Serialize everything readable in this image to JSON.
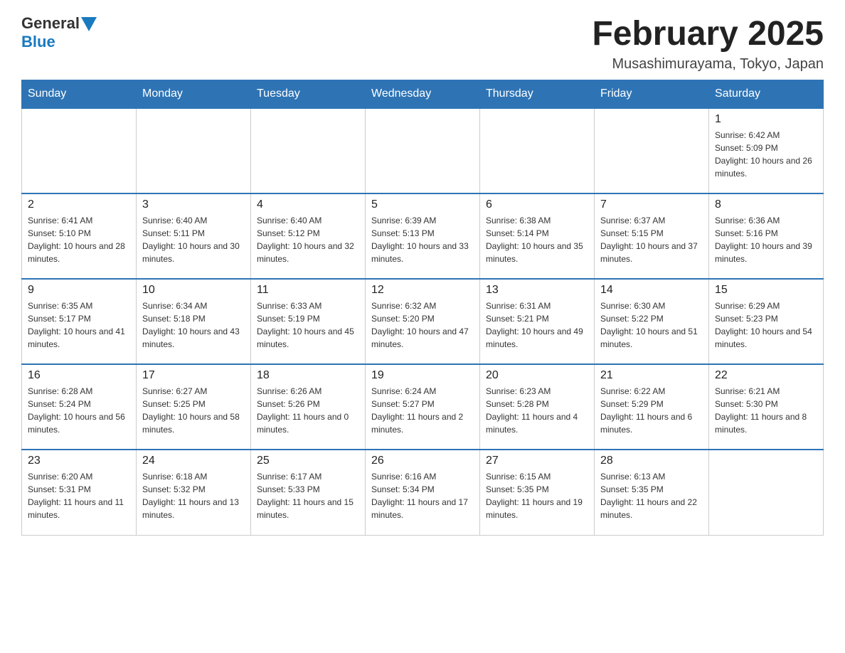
{
  "logo": {
    "general": "General",
    "blue": "Blue"
  },
  "title": "February 2025",
  "subtitle": "Musashimurayama, Tokyo, Japan",
  "weekdays": [
    "Sunday",
    "Monday",
    "Tuesday",
    "Wednesday",
    "Thursday",
    "Friday",
    "Saturday"
  ],
  "weeks": [
    [
      {
        "day": "",
        "info": ""
      },
      {
        "day": "",
        "info": ""
      },
      {
        "day": "",
        "info": ""
      },
      {
        "day": "",
        "info": ""
      },
      {
        "day": "",
        "info": ""
      },
      {
        "day": "",
        "info": ""
      },
      {
        "day": "1",
        "info": "Sunrise: 6:42 AM\nSunset: 5:09 PM\nDaylight: 10 hours and 26 minutes."
      }
    ],
    [
      {
        "day": "2",
        "info": "Sunrise: 6:41 AM\nSunset: 5:10 PM\nDaylight: 10 hours and 28 minutes."
      },
      {
        "day": "3",
        "info": "Sunrise: 6:40 AM\nSunset: 5:11 PM\nDaylight: 10 hours and 30 minutes."
      },
      {
        "day": "4",
        "info": "Sunrise: 6:40 AM\nSunset: 5:12 PM\nDaylight: 10 hours and 32 minutes."
      },
      {
        "day": "5",
        "info": "Sunrise: 6:39 AM\nSunset: 5:13 PM\nDaylight: 10 hours and 33 minutes."
      },
      {
        "day": "6",
        "info": "Sunrise: 6:38 AM\nSunset: 5:14 PM\nDaylight: 10 hours and 35 minutes."
      },
      {
        "day": "7",
        "info": "Sunrise: 6:37 AM\nSunset: 5:15 PM\nDaylight: 10 hours and 37 minutes."
      },
      {
        "day": "8",
        "info": "Sunrise: 6:36 AM\nSunset: 5:16 PM\nDaylight: 10 hours and 39 minutes."
      }
    ],
    [
      {
        "day": "9",
        "info": "Sunrise: 6:35 AM\nSunset: 5:17 PM\nDaylight: 10 hours and 41 minutes."
      },
      {
        "day": "10",
        "info": "Sunrise: 6:34 AM\nSunset: 5:18 PM\nDaylight: 10 hours and 43 minutes."
      },
      {
        "day": "11",
        "info": "Sunrise: 6:33 AM\nSunset: 5:19 PM\nDaylight: 10 hours and 45 minutes."
      },
      {
        "day": "12",
        "info": "Sunrise: 6:32 AM\nSunset: 5:20 PM\nDaylight: 10 hours and 47 minutes."
      },
      {
        "day": "13",
        "info": "Sunrise: 6:31 AM\nSunset: 5:21 PM\nDaylight: 10 hours and 49 minutes."
      },
      {
        "day": "14",
        "info": "Sunrise: 6:30 AM\nSunset: 5:22 PM\nDaylight: 10 hours and 51 minutes."
      },
      {
        "day": "15",
        "info": "Sunrise: 6:29 AM\nSunset: 5:23 PM\nDaylight: 10 hours and 54 minutes."
      }
    ],
    [
      {
        "day": "16",
        "info": "Sunrise: 6:28 AM\nSunset: 5:24 PM\nDaylight: 10 hours and 56 minutes."
      },
      {
        "day": "17",
        "info": "Sunrise: 6:27 AM\nSunset: 5:25 PM\nDaylight: 10 hours and 58 minutes."
      },
      {
        "day": "18",
        "info": "Sunrise: 6:26 AM\nSunset: 5:26 PM\nDaylight: 11 hours and 0 minutes."
      },
      {
        "day": "19",
        "info": "Sunrise: 6:24 AM\nSunset: 5:27 PM\nDaylight: 11 hours and 2 minutes."
      },
      {
        "day": "20",
        "info": "Sunrise: 6:23 AM\nSunset: 5:28 PM\nDaylight: 11 hours and 4 minutes."
      },
      {
        "day": "21",
        "info": "Sunrise: 6:22 AM\nSunset: 5:29 PM\nDaylight: 11 hours and 6 minutes."
      },
      {
        "day": "22",
        "info": "Sunrise: 6:21 AM\nSunset: 5:30 PM\nDaylight: 11 hours and 8 minutes."
      }
    ],
    [
      {
        "day": "23",
        "info": "Sunrise: 6:20 AM\nSunset: 5:31 PM\nDaylight: 11 hours and 11 minutes."
      },
      {
        "day": "24",
        "info": "Sunrise: 6:18 AM\nSunset: 5:32 PM\nDaylight: 11 hours and 13 minutes."
      },
      {
        "day": "25",
        "info": "Sunrise: 6:17 AM\nSunset: 5:33 PM\nDaylight: 11 hours and 15 minutes."
      },
      {
        "day": "26",
        "info": "Sunrise: 6:16 AM\nSunset: 5:34 PM\nDaylight: 11 hours and 17 minutes."
      },
      {
        "day": "27",
        "info": "Sunrise: 6:15 AM\nSunset: 5:35 PM\nDaylight: 11 hours and 19 minutes."
      },
      {
        "day": "28",
        "info": "Sunrise: 6:13 AM\nSunset: 5:35 PM\nDaylight: 11 hours and 22 minutes."
      },
      {
        "day": "",
        "info": ""
      }
    ]
  ]
}
